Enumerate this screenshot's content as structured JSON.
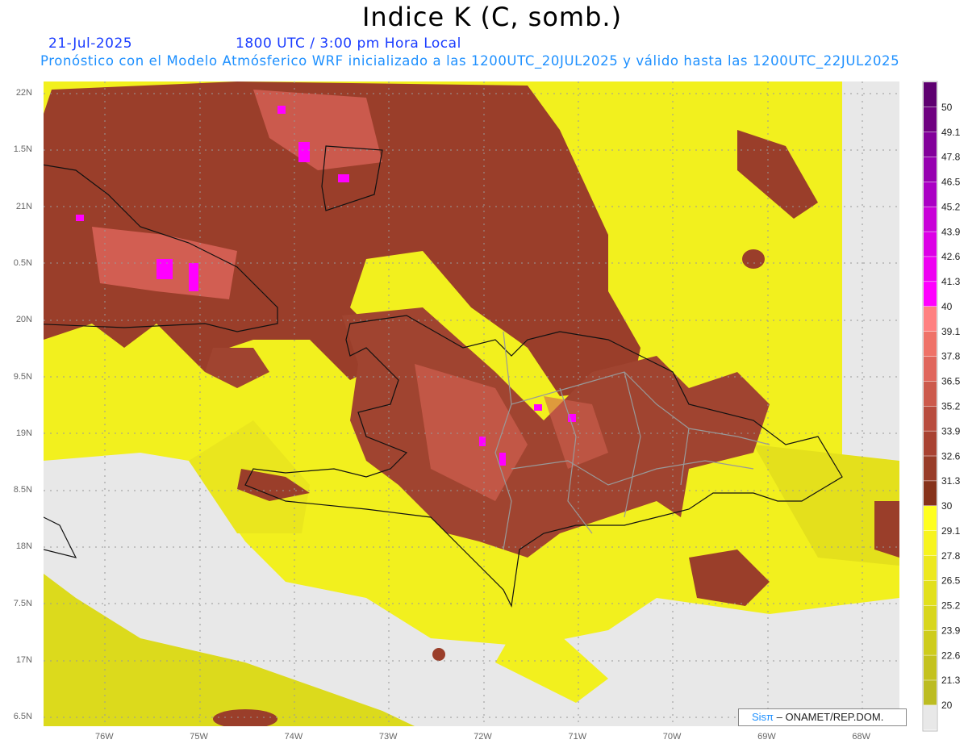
{
  "title": "Indice K (C, somb.)",
  "date": "21-Jul-2025",
  "time": "1800 UTC / 3:00 pm Hora Local",
  "description": "Pronóstico con el Modelo Atmósferico WRF inicializado a las 1200UTC_20JUL2025 y válido hasta las  1200UTC_22JUL2025",
  "lat_labels": [
    "22N",
    "1.5N",
    "21N",
    "0.5N",
    "20N",
    "9.5N",
    "19N",
    "8.5N",
    "18N",
    "7.5N",
    "17N",
    "6.5N"
  ],
  "lon_labels": [
    "76W",
    "75W",
    "74W",
    "73W",
    "72W",
    "71W",
    "70W",
    "69W",
    "68W"
  ],
  "credit": {
    "brand": "Sisπ",
    "text": "– ONAMET/REP.DOM."
  },
  "colorbar": {
    "labels": [
      "50",
      "49.1",
      "47.8",
      "46.5",
      "45.2",
      "43.9",
      "42.6",
      "41.3",
      "40",
      "39.1",
      "37.8",
      "36.5",
      "35.2",
      "33.9",
      "32.6",
      "31.3",
      "30",
      "29.1",
      "27.8",
      "26.5",
      "25.2",
      "23.9",
      "22.6",
      "21.3",
      "20"
    ],
    "colors": [
      "#5e0070",
      "#6e0080",
      "#82009a",
      "#9600b0",
      "#aa00c4",
      "#c800d8",
      "#dc00e6",
      "#ee00f2",
      "#ff00ff",
      "#ff8080",
      "#ef7268",
      "#e0665c",
      "#cc5a4c",
      "#b84c3e",
      "#a84232",
      "#983c28",
      "#86321a",
      "#ffff20",
      "#f7f41e",
      "#ede81e",
      "#e2e01c",
      "#d8d61c",
      "#cecc1c",
      "#c4c21e",
      "#bcbc22",
      "#e8e8e8"
    ]
  }
}
